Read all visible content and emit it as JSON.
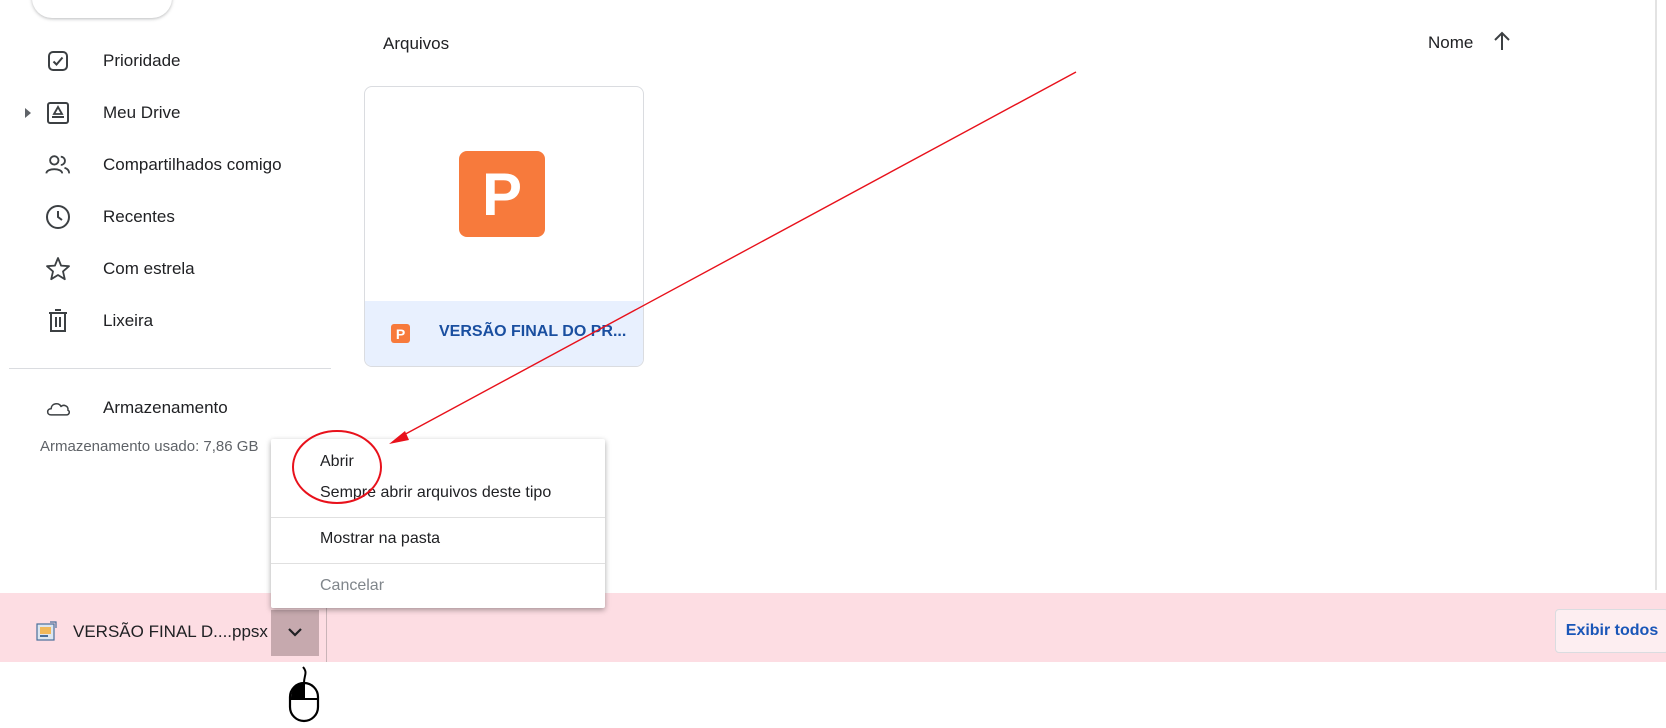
{
  "sidebar": {
    "items": [
      {
        "label": "Prioridade",
        "icon": "priority-check-icon"
      },
      {
        "label": "Meu Drive",
        "icon": "my-drive-icon"
      },
      {
        "label": "Compartilhados comigo",
        "icon": "shared-people-icon"
      },
      {
        "label": "Recentes",
        "icon": "clock-icon"
      },
      {
        "label": "Com estrela",
        "icon": "star-icon"
      },
      {
        "label": "Lixeira",
        "icon": "trash-icon"
      }
    ],
    "storage": {
      "label": "Armazenamento",
      "icon": "cloud-icon",
      "used_text": "Armazenamento usado: 7,86 GB"
    }
  },
  "main": {
    "section_title": "Arquivos",
    "sort": {
      "label": "Nome",
      "direction_icon": "arrow-up-icon"
    },
    "files": [
      {
        "name": "VERSÃO FINAL DO PR...",
        "type_glyph": "P",
        "type_icon": "powerpoint-icon"
      }
    ]
  },
  "context_menu": {
    "items": [
      {
        "label": "Abrir"
      },
      {
        "label": "Sempre abrir arquivos deste tipo"
      },
      {
        "label": "Mostrar na pasta"
      },
      {
        "label": "Cancelar"
      }
    ]
  },
  "download_bar": {
    "file_name": "VERSÃO FINAL D....ppsx",
    "file_icon": "slideshow-file-icon",
    "menu_icon": "chevron-down-icon",
    "show_all_label": "Exibir todos"
  },
  "colors": {
    "powerpoint_orange": "#f77a3c",
    "selected_footer": "#e8f0fe",
    "download_bar_bg": "#fddde3",
    "annotation_red": "#e8111b",
    "link_blue": "#1a4fa0"
  }
}
